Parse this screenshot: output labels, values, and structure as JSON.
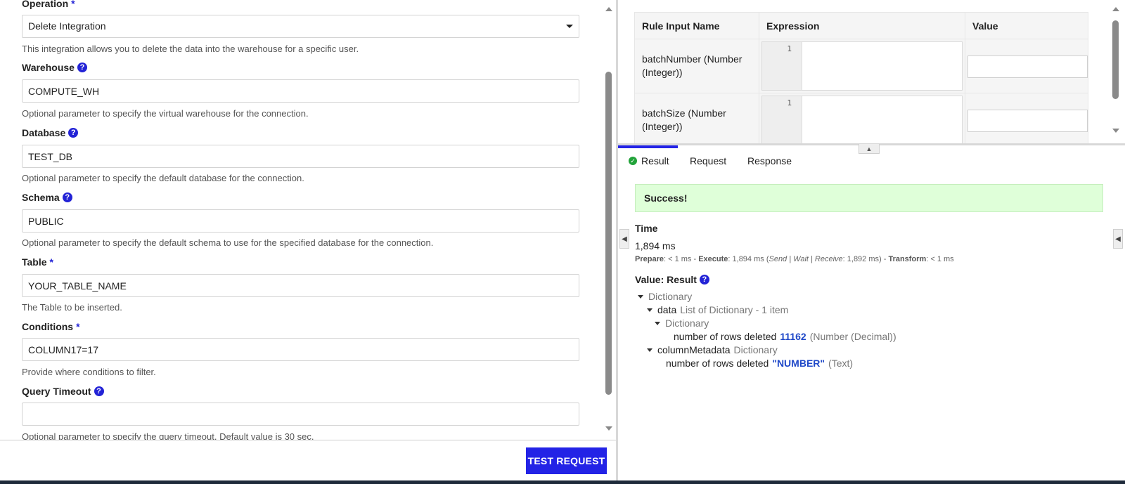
{
  "form": {
    "operation": {
      "label": "Operation",
      "required": "*",
      "value": "Delete Integration",
      "help": "This integration allows you to delete the data into the warehouse for a specific user."
    },
    "warehouse": {
      "label": "Warehouse",
      "value": "COMPUTE_WH",
      "help": "Optional parameter to specify the virtual warehouse for the connection."
    },
    "database": {
      "label": "Database",
      "value": "TEST_DB",
      "help": "Optional parameter to specify the default database for the connection."
    },
    "schema": {
      "label": "Schema",
      "value": "PUBLIC",
      "help": "Optional parameter to specify the default schema to use for the specified database for the connection."
    },
    "table": {
      "label": "Table",
      "required": "*",
      "value": "YOUR_TABLE_NAME",
      "help": "The Table to be inserted."
    },
    "conditions": {
      "label": "Conditions",
      "required": "*",
      "value": "COLUMN17=17",
      "help": "Provide where conditions to filter."
    },
    "query_timeout": {
      "label": "Query Timeout",
      "value": "",
      "help": "Optional parameter to specify the query timeout. Default value is 30 sec."
    },
    "help_icon_glyph": "?"
  },
  "footer": {
    "test_request_label": "TEST REQUEST"
  },
  "rule_inputs": {
    "headers": [
      "Rule Input Name",
      "Expression",
      "Value"
    ],
    "rows": [
      {
        "name": "batchNumber (Number (Integer))",
        "line": "1"
      },
      {
        "name": "batchSize (Number (Integer))",
        "line": "1"
      }
    ]
  },
  "tabs": [
    "Result",
    "Request",
    "Response"
  ],
  "result": {
    "status": "Success!",
    "time_label": "Time",
    "time_value": "1,894 ms",
    "timing": {
      "prepare_label": "Prepare",
      "prepare_value": ": < 1 ms - ",
      "execute_label": "Execute",
      "execute_value": ": 1,894 ms (",
      "send_wait_receive": "Send | Wait | Receive",
      "swr_value": ": 1,892 ms) - ",
      "transform_label": "Transform",
      "transform_value": ": < 1 ms"
    },
    "value_label": "Value: Result",
    "tree": {
      "root": "Dictionary",
      "data_key": "data",
      "data_type": "List of Dictionary - 1 item",
      "inner_dict": "Dictionary",
      "rows_deleted_key": "number of rows deleted",
      "rows_deleted_value": "11162",
      "rows_deleted_type": "(Number (Decimal))",
      "column_metadata_key": "columnMetadata",
      "column_metadata_type": "Dictionary",
      "meta_rows_key": "number of rows deleted",
      "meta_rows_value": "\"NUMBER\"",
      "meta_rows_type": "(Text)"
    }
  },
  "colors": {
    "accent": "#2323e6",
    "success_bg": "#dfffd9",
    "value_blue": "#1f48c8"
  }
}
